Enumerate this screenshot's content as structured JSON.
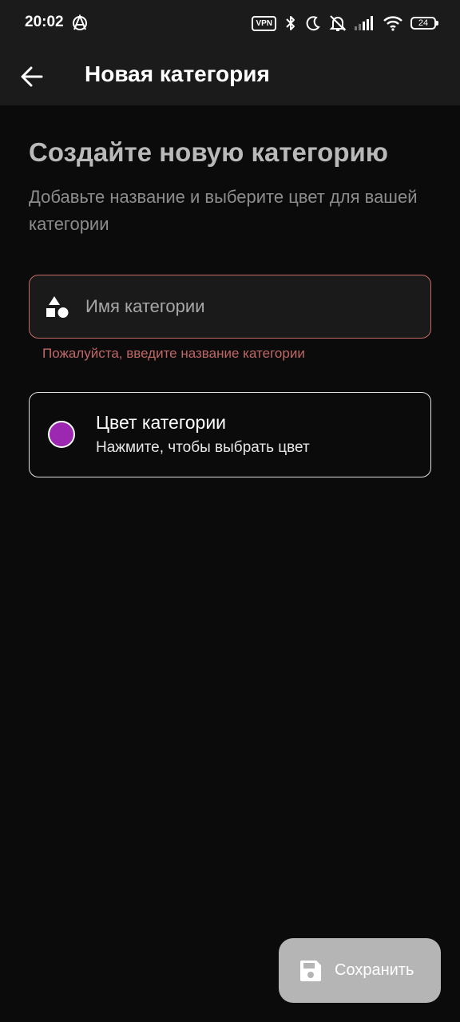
{
  "status_bar": {
    "time": "20:02",
    "vpn_label": "VPN",
    "battery_level": "24",
    "icons": [
      "anarchy-icon",
      "vpn-icon",
      "bluetooth-icon",
      "moon-icon",
      "alarm-off-icon",
      "signal-icon",
      "wifi-icon",
      "battery-icon"
    ]
  },
  "app_bar": {
    "title": "Новая категория",
    "back_icon": "arrow-left-icon"
  },
  "content": {
    "heading": "Создайте новую категорию",
    "subtitle": "Добавьте название и выберите цвет для вашей категории"
  },
  "name_field": {
    "placeholder": "Имя категории",
    "value": "",
    "icon": "shapes-icon",
    "error": "Пожалуйста, введите название категории",
    "error_color": "#c96a6a"
  },
  "color_picker": {
    "title": "Цвет категории",
    "hint": "Нажмите, чтобы выбрать цвет",
    "selected_color": "#9c27b0"
  },
  "save_button": {
    "label": "Сохранить",
    "icon": "save-icon"
  },
  "colors": {
    "background": "#0b0b0b",
    "app_bar": "#1b1b1b",
    "fab": "#b5b5b5"
  }
}
